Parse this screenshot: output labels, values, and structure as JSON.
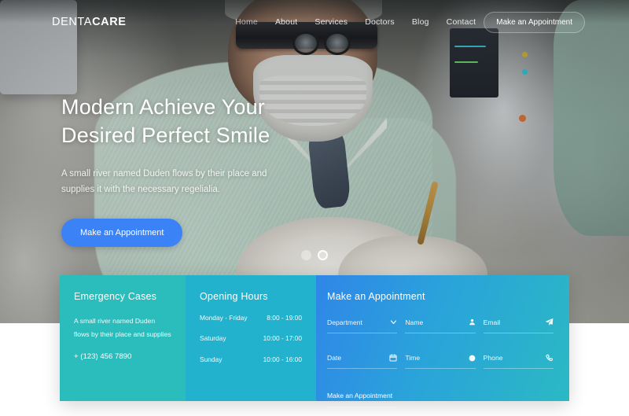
{
  "brand": {
    "part1": "DENTA",
    "part2": "CARE"
  },
  "nav": {
    "links": [
      {
        "label": "Home",
        "active": true
      },
      {
        "label": "About",
        "active": false
      },
      {
        "label": "Services",
        "active": false
      },
      {
        "label": "Doctors",
        "active": false
      },
      {
        "label": "Blog",
        "active": false
      },
      {
        "label": "Contact",
        "active": false
      }
    ],
    "cta_label": "Make an Appointment"
  },
  "hero": {
    "title_line1": "Modern Achieve Your",
    "title_line2": "Desired Perfect Smile",
    "subtitle": "A small river named Duden flows by their place and supplies it with the necessary regelialia.",
    "button_label": "Make an Appointment",
    "slider": {
      "dots": 2,
      "active_index": 1
    }
  },
  "panels": {
    "emergency": {
      "title": "Emergency Cases",
      "body": "A small river named Duden flows by their place and supplies",
      "phone": "+ (123) 456 7890",
      "color": "#2bbcbc"
    },
    "hours": {
      "title": "Opening Hours",
      "color": "#22b2cd",
      "rows": [
        {
          "day": "Monday - Friday",
          "time": "8:00 - 19:00"
        },
        {
          "day": "Saturday",
          "time": "10:00 - 17:00"
        },
        {
          "day": "Sunday",
          "time": "10:00 - 16:00"
        }
      ]
    },
    "appointment": {
      "title": "Make an Appointment",
      "gradient_from": "#2f86e8",
      "gradient_to": "#2bb9c4",
      "fields": [
        {
          "label": "Department",
          "icon": "chevron-down-icon"
        },
        {
          "label": "Name",
          "icon": "user-icon"
        },
        {
          "label": "Email",
          "icon": "send-icon"
        },
        {
          "label": "Date",
          "icon": "calendar-icon"
        },
        {
          "label": "Time",
          "icon": "clock-icon"
        },
        {
          "label": "Phone",
          "icon": "phone-icon"
        }
      ],
      "submit_label": "Make an Appointment"
    }
  }
}
